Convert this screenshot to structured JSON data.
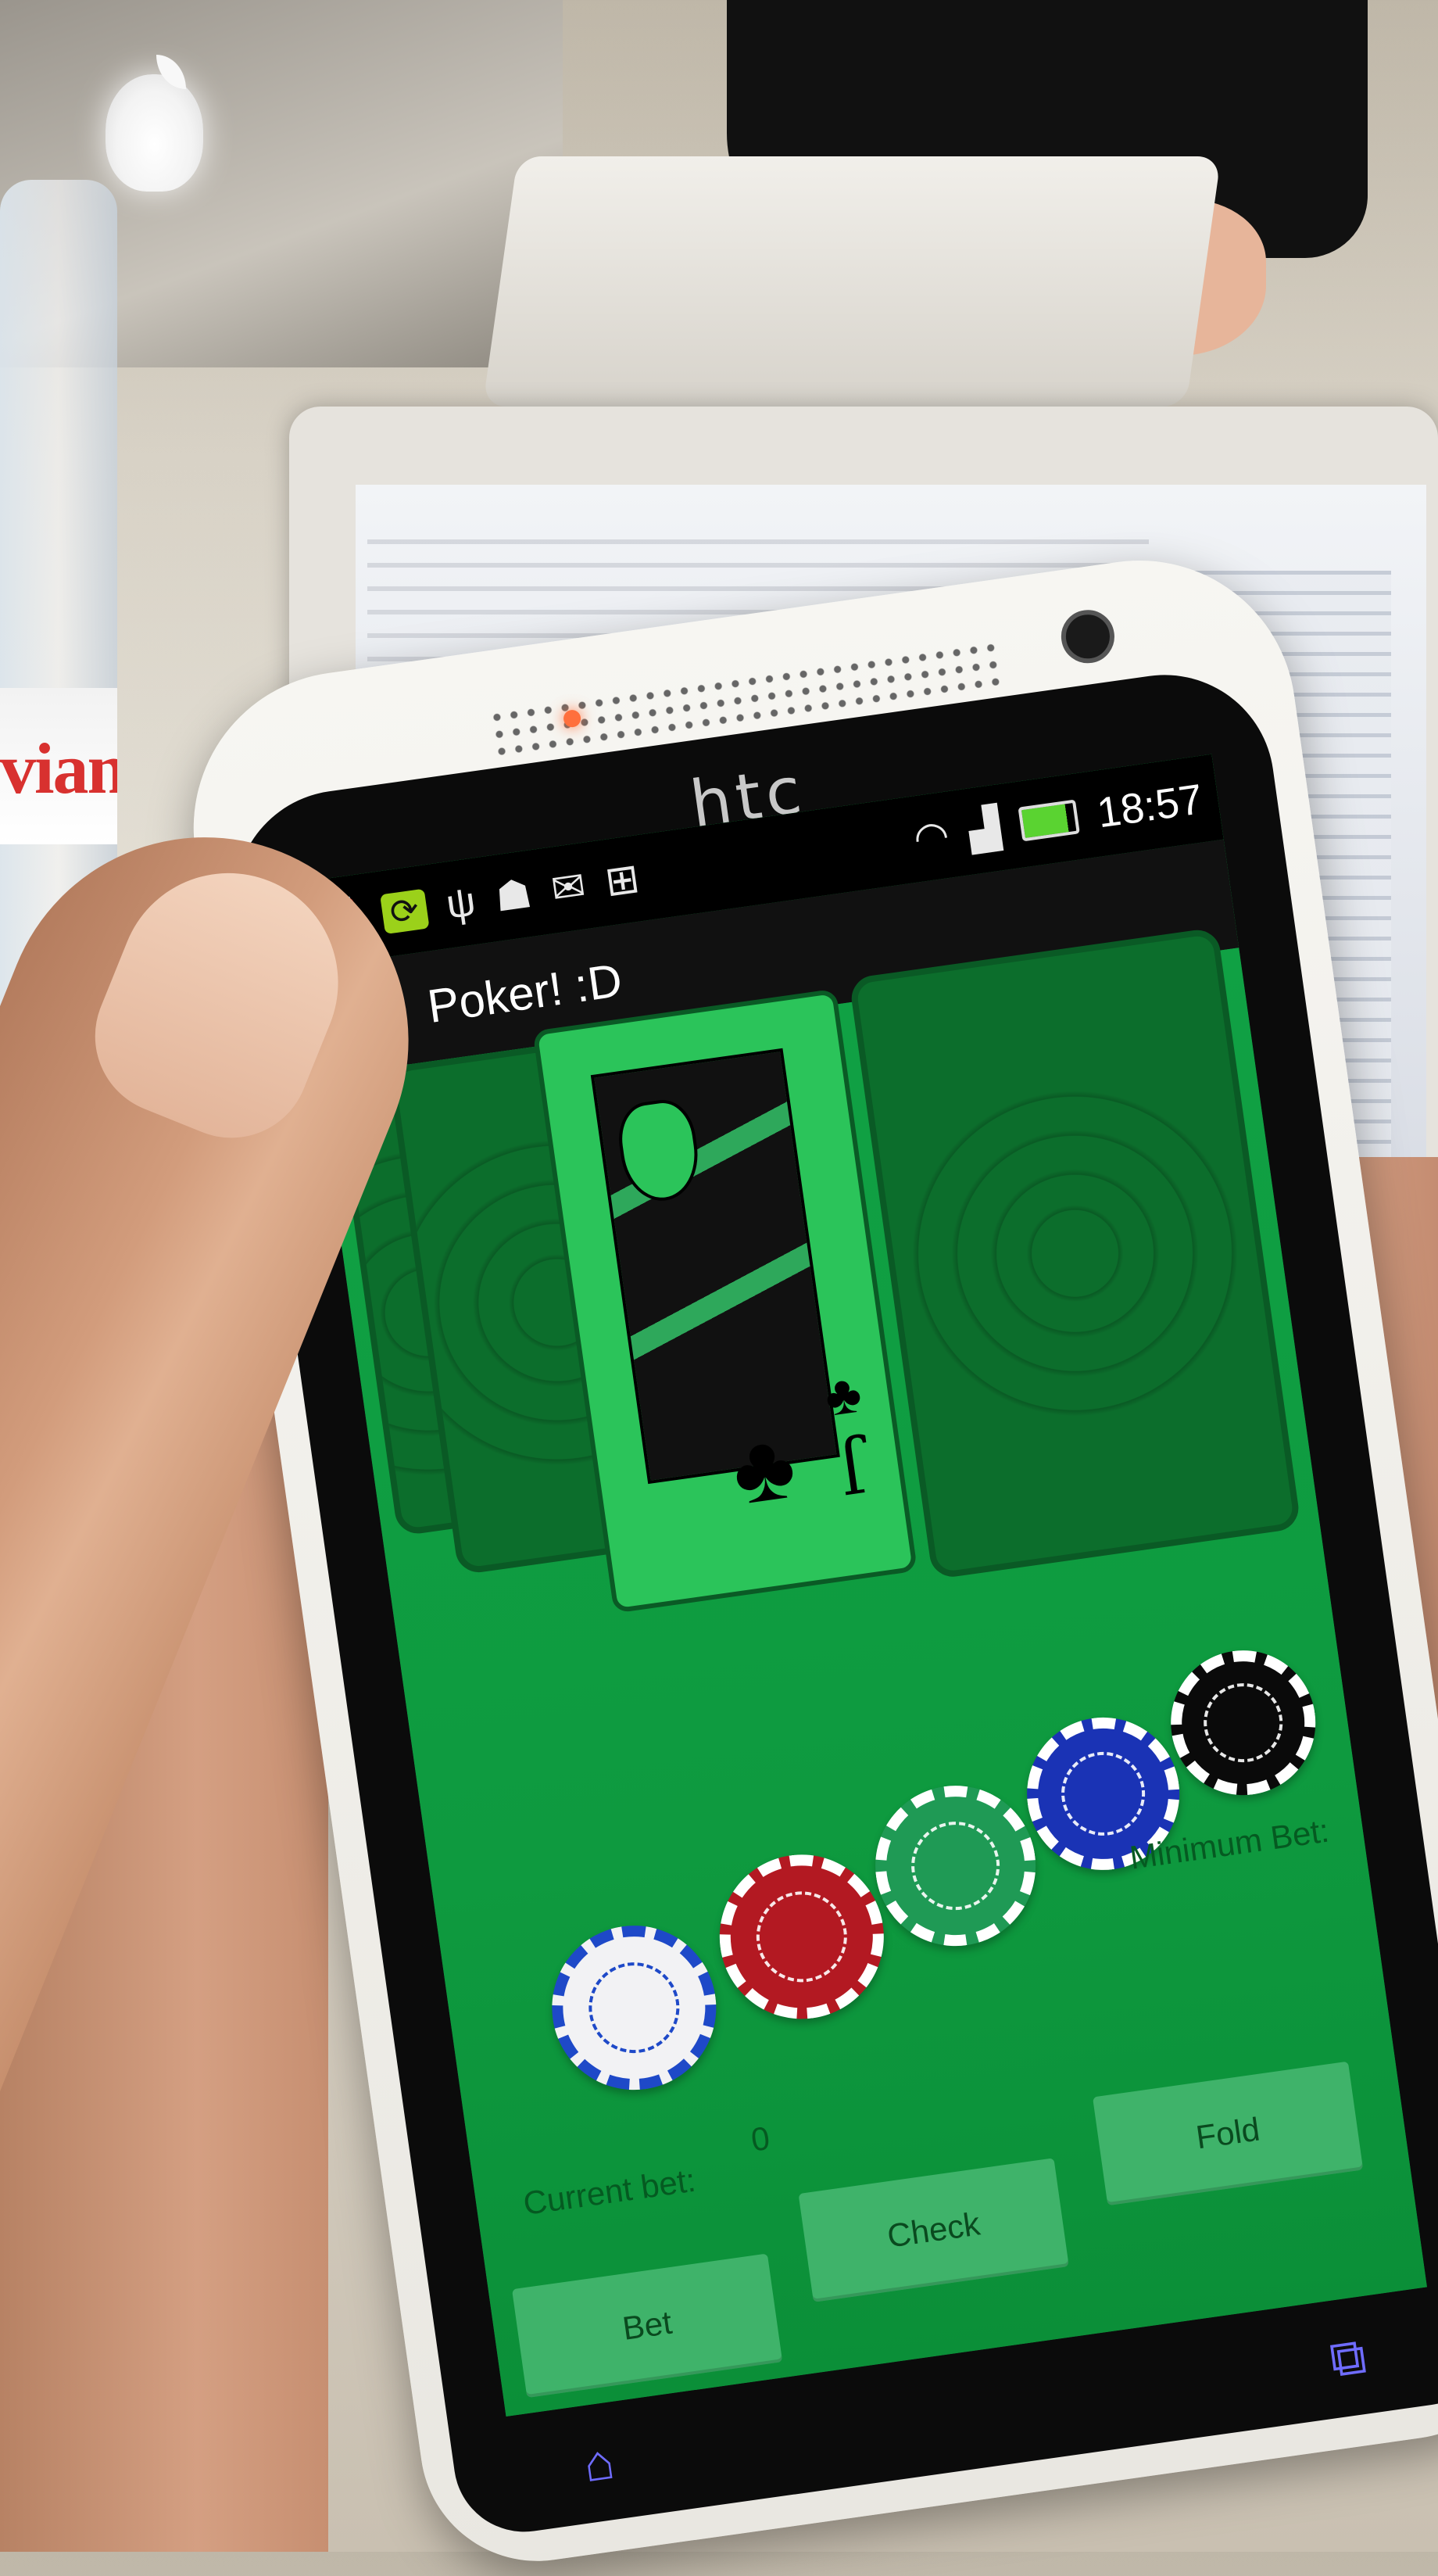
{
  "background": {
    "bottle_brand": "vian",
    "colors": {
      "table_green": "#0e9a3f",
      "phone_white": "#f4f3ef"
    }
  },
  "phone": {
    "brand": "htc",
    "status_bar": {
      "time": "18:57",
      "left_icons": [
        "alarm-icon",
        "sync-icon",
        "usb-icon",
        "android-debug-icon",
        "gmail-icon",
        "google-plus-icon"
      ],
      "right_icons": [
        "wifi-icon",
        "signal-icon",
        "battery-icon"
      ]
    },
    "action_bar": {
      "title": "Poker! :D"
    },
    "game": {
      "cards": {
        "hand_card_rank": "J",
        "hand_card_suit": "clubs"
      },
      "chips": [
        {
          "color": "white",
          "hex": "#f2f2f4",
          "stripe": "#1e49c8"
        },
        {
          "color": "red",
          "hex": "#b31922",
          "stripe": "#ffffff"
        },
        {
          "color": "green",
          "hex": "#1f9a55",
          "stripe": "#ffffff"
        },
        {
          "color": "blue",
          "hex": "#1a33b5",
          "stripe": "#ffffff"
        },
        {
          "color": "black",
          "hex": "#0a0a0a",
          "stripe": "#ffffff"
        }
      ],
      "minimum_bet_label": "Minimum Bet:",
      "current_bet_label": "Current bet:",
      "current_bet_value": "0",
      "buttons": {
        "bet": "Bet",
        "check": "Check",
        "fold": "Fold"
      }
    },
    "nav_icons": [
      "home-icon",
      "recent-apps-icon"
    ]
  }
}
